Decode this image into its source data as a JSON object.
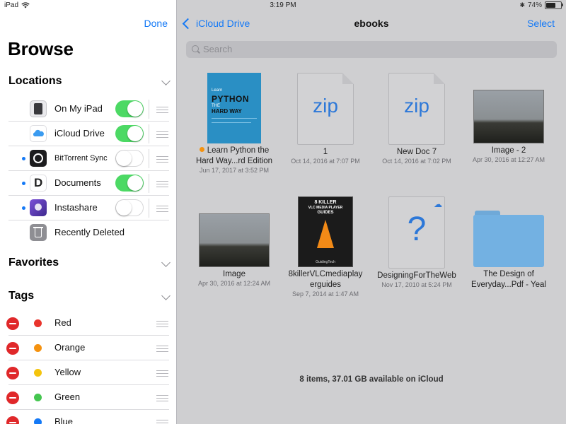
{
  "status": {
    "device": "iPad",
    "time": "3:19 PM",
    "battery": "74%",
    "battery_fraction": 0.74
  },
  "sidebar": {
    "done": "Done",
    "title": "Browse",
    "sections": {
      "locations": "Locations",
      "favorites": "Favorites",
      "tags": "Tags"
    },
    "locations": [
      {
        "label": "On My iPad",
        "toggle": "on",
        "icon": "ipad-icon"
      },
      {
        "label": "iCloud Drive",
        "toggle": "on",
        "icon": "icloud-icon"
      },
      {
        "label": "BitTorrent Sync",
        "toggle": "off",
        "icon": "bittorrent-sync-icon"
      },
      {
        "label": "Documents",
        "toggle": "on",
        "icon": "documents-app-icon"
      },
      {
        "label": "Instashare",
        "toggle": "off",
        "icon": "instashare-icon"
      },
      {
        "label": "Recently Deleted",
        "icon": "trash-icon"
      }
    ],
    "tags": [
      {
        "label": "Red",
        "color": "#e9342c"
      },
      {
        "label": "Orange",
        "color": "#f5920f"
      },
      {
        "label": "Yellow",
        "color": "#f4c40d"
      },
      {
        "label": "Green",
        "color": "#45c650"
      },
      {
        "label": "Blue",
        "color": "#1479f6"
      }
    ]
  },
  "main": {
    "back": "iCloud Drive",
    "title": "ebooks",
    "select": "Select",
    "search_placeholder": "Search",
    "files": [
      {
        "name1": "Learn Python the",
        "name2": "Hard Way...rd Edition",
        "date": "Jun 17, 2017 at 3:52 PM",
        "tag_color": "#f5920f",
        "kind": "book-cover",
        "cover_lines": [
          "Learn",
          "PYTHON",
          "THE",
          "HARD WAY"
        ]
      },
      {
        "name1": "1",
        "name2": "",
        "date": "Oct 14, 2016 at 7:07 PM",
        "kind": "zip",
        "ext": "zip"
      },
      {
        "name1": "New Doc 7",
        "name2": "",
        "date": "Oct 14, 2016 at 7:02 PM",
        "kind": "zip",
        "ext": "zip"
      },
      {
        "name1": "Image - 2",
        "name2": "",
        "date": "Apr 30, 2016 at 12:27 AM",
        "kind": "photo"
      },
      {
        "name1": "Image",
        "name2": "",
        "date": "Apr 30, 2016 at 12:24 AM",
        "kind": "photo"
      },
      {
        "name1": "8killerVLCmediaplay",
        "name2": "erguides",
        "date": "Sep 7, 2014 at 1:47 AM",
        "kind": "vlc-cover",
        "cover_lines": [
          "8 KILLER",
          "VLC MEDIA PLAYER",
          "GUIDES",
          "GuidingTech"
        ]
      },
      {
        "name1": "DesigningForTheWeb",
        "name2": "",
        "date": "Nov 17, 2010 at 5:24 PM",
        "kind": "unknown",
        "ext": "?"
      },
      {
        "name1": "The Design of",
        "name2": "Everyday...Pdf - Yeal",
        "date": "",
        "kind": "folder"
      }
    ],
    "footer": "8 items, 37.01 GB available on iCloud"
  }
}
